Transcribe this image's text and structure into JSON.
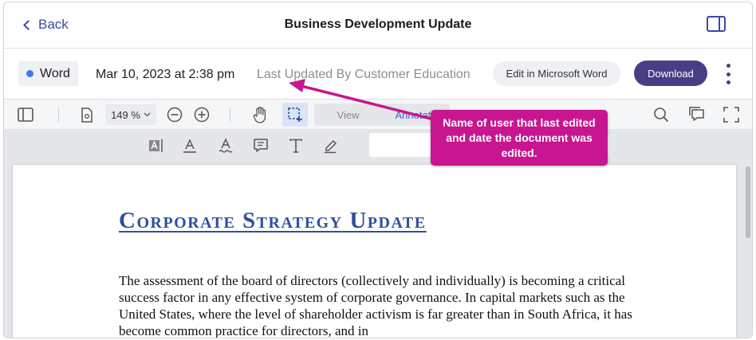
{
  "header": {
    "back_label": "Back",
    "title": "Business Development Update"
  },
  "infobar": {
    "file_type": "Word",
    "file_type_color": "#3d7be0",
    "date": "Mar 10, 2023 at 2:38 pm",
    "last_updated": "Last Updated By Customer Education",
    "edit_button": "Edit in Microsoft Word",
    "download_button": "Download",
    "accent_color": "#473e86"
  },
  "toolbar": {
    "zoom": "149 %",
    "modes": {
      "view": "View",
      "annotate": "Annotate"
    }
  },
  "document": {
    "title": "Corporate Strategy Update",
    "body": "The assessment of the board of directors (collectively and individually) is becoming a critical success factor in any effective system of corporate governance. In capital markets such as the United States, where the level of shareholder activism is far greater than in South Africa, it has become common practice for directors, and in"
  },
  "callout": {
    "text": "Name of user that last edited and date the document was edited.",
    "color": "#c7168f"
  }
}
